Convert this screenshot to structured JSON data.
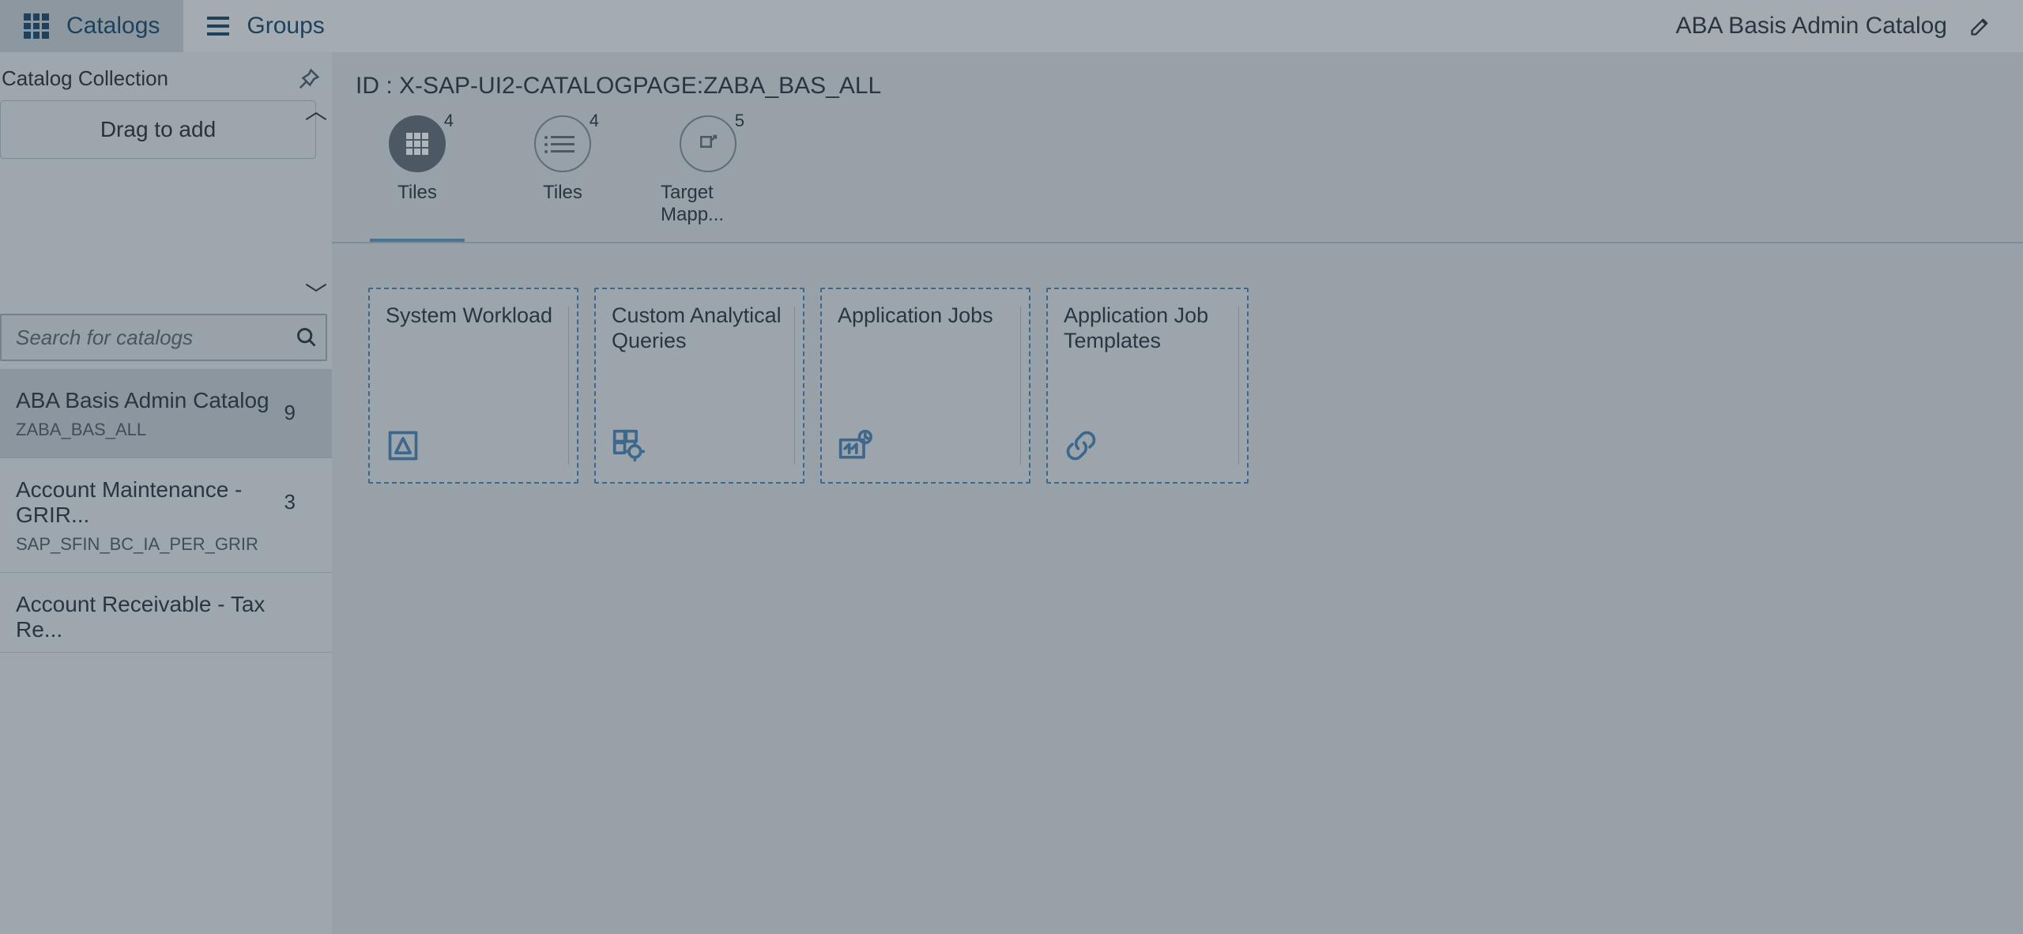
{
  "top_tabs": {
    "catalogs": "Catalogs",
    "groups": "Groups"
  },
  "header": {
    "title": "ABA Basis Admin Catalog"
  },
  "left_panel": {
    "collection_label": "Catalog Collection",
    "drag_label": "Drag to add",
    "search_placeholder": "Search for catalogs",
    "items": [
      {
        "title": "ABA Basis Admin Catalog",
        "subtitle": "ZABA_BAS_ALL",
        "count": "9",
        "selected": true
      },
      {
        "title": "Account Maintenance - GRIR...",
        "subtitle": "SAP_SFIN_BC_IA_PER_GRIR",
        "count": "3",
        "selected": false
      },
      {
        "title": "Account Receivable - Tax Re...",
        "subtitle": "",
        "count": "",
        "selected": false
      }
    ]
  },
  "main": {
    "id_line": "ID : X-SAP-UI2-CATALOGPAGE:ZABA_BAS_ALL",
    "view_tabs": [
      {
        "label": "Tiles",
        "badge": "4",
        "active": true,
        "kind": "grid"
      },
      {
        "label": "Tiles",
        "badge": "4",
        "active": false,
        "kind": "list"
      },
      {
        "label": "Target Mapp...",
        "badge": "5",
        "active": false,
        "kind": "share"
      }
    ],
    "tiles": [
      {
        "title": "System Workload",
        "icon": "workload"
      },
      {
        "title": "Custom Analytical Queries",
        "icon": "custom-query"
      },
      {
        "title": "Application Jobs",
        "icon": "jobs"
      },
      {
        "title": "Application Job Templates",
        "icon": "link"
      }
    ]
  }
}
